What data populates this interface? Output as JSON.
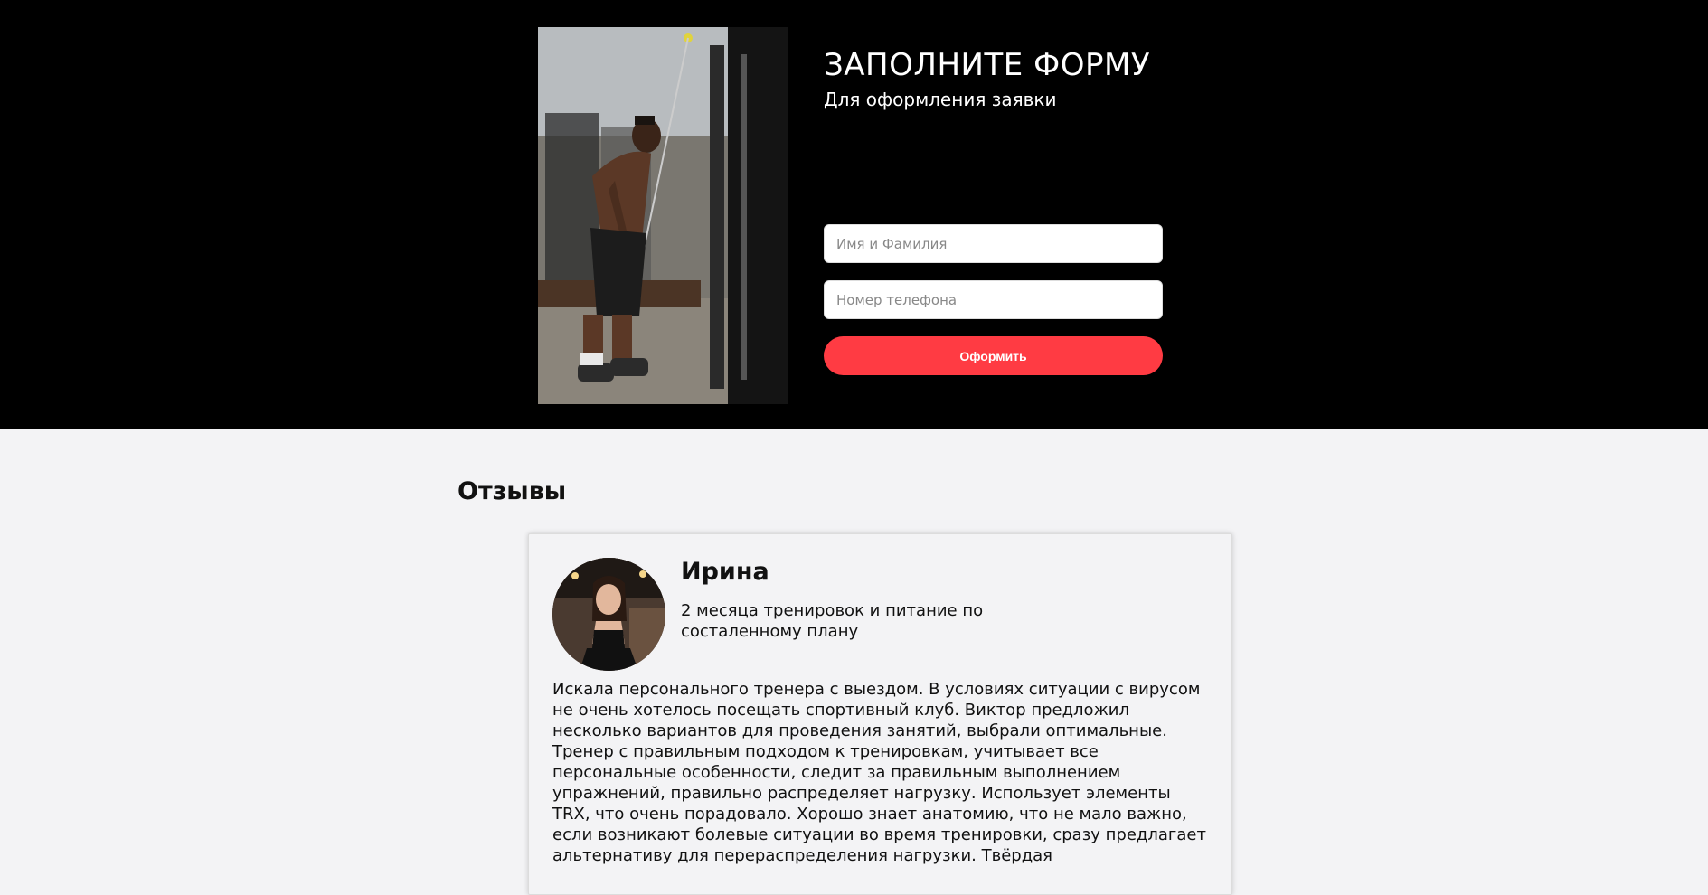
{
  "hero": {
    "photo_icon": "gym-trainer-photo",
    "form_title": "ЗАПОЛНИТЕ ФОРМУ",
    "form_subtitle": "Для оформления заявки",
    "name_placeholder": "Имя и Фамилия",
    "phone_placeholder": "Номер телефона",
    "submit_label": "Оформить"
  },
  "reviews": {
    "title": "Отзывы",
    "items": [
      {
        "avatar_icon": "reviewer-avatar-photo",
        "name": "Ирина",
        "program": "2 месяца тренировок и питание по состаленному плану",
        "text": "Искала персонального тренера с выездом. В условиях ситуации с вирусом не очень хотелось посещать спортивный клуб. Виктор предложил несколько вариантов для проведения занятий, выбрали оптимальные. Тренер с правильным подходом к тренировкам, учитывает все персональные особенности, следит за правильным выполнением упражнений, правильно распределяет нагрузку. Использует элементы TRX, что очень порадовало. Хорошо знает анатомию, что не мало важно, если возникают болевые ситуации во время тренировки, сразу предлагает альтернативу для перераспределения нагрузки. Твёрдая"
      }
    ]
  },
  "colors": {
    "hero_background": "#000000",
    "page_background": "#f3f3f5",
    "accent_button": "#ff3b43"
  }
}
